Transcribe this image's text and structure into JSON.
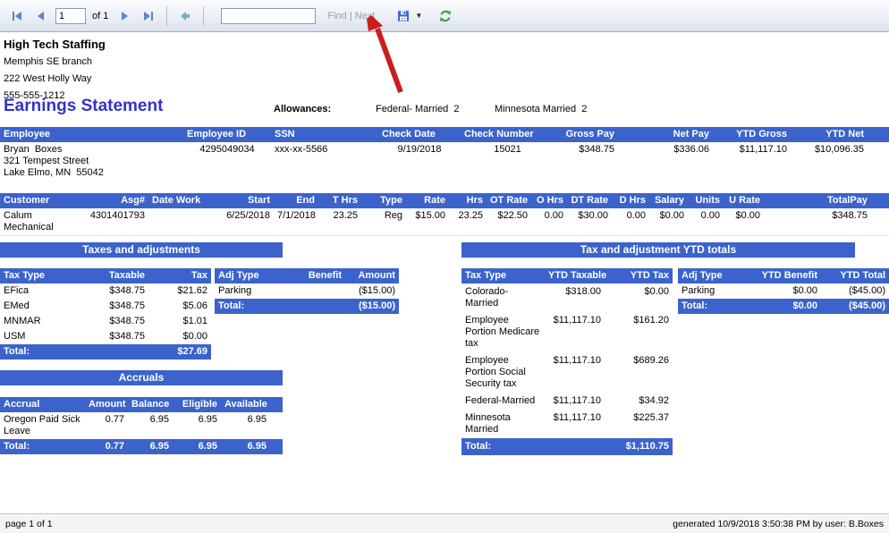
{
  "toolbar": {
    "page_value": "1",
    "of_label": "of 1",
    "find_label": "Find",
    "find_sep": "|",
    "next_label": "Next"
  },
  "company": {
    "name": "High Tech Staffing",
    "branch": "Memphis SE branch",
    "address": "222 West Holly Way",
    "phone": "555-555-1212"
  },
  "statement": {
    "title": "Earnings Statement",
    "allowances_label": "Allowances:",
    "federal_allowance": "Federal- Married  2",
    "state_allowance": "Minnesota Married  2"
  },
  "employee_table": {
    "headers": [
      "Employee",
      "Employee ID",
      "SSN",
      "Check Date",
      "Check Number",
      "Gross Pay",
      "Net Pay",
      "YTD Gross",
      "YTD Net"
    ],
    "row": {
      "name": "Bryan  Boxes",
      "address1": "321 Tempest Street",
      "address2": "Lake Elmo, MN  55042",
      "values": [
        "4295049034",
        "xxx-xx-5566",
        "9/19/2018",
        "15021",
        "$348.75",
        "$336.06",
        "$11,117.10",
        "$10,096.35"
      ]
    }
  },
  "assignment_table": {
    "headers": [
      "Customer",
      "Asg#",
      "Date Work",
      "Start",
      "End",
      "T Hrs",
      "Type",
      "Rate",
      "Hrs",
      "OT Rate",
      "O Hrs",
      "DT Rate",
      "D Hrs",
      "Salary",
      "Units",
      "U Rate",
      "TotalPay"
    ],
    "row": [
      "Calum Mechanical",
      "4301401793",
      "",
      "6/25/2018",
      "7/1/2018",
      "23.25",
      "Reg",
      "$15.00",
      "23.25",
      "$22.50",
      "0.00",
      "$30.00",
      "0.00",
      "$0.00",
      "0.00",
      "$0.00",
      "$348.75"
    ]
  },
  "taxes_section": {
    "title": "Taxes and adjustments",
    "tax_table": {
      "headers": [
        "Tax Type",
        "Taxable",
        "Tax"
      ],
      "rows": [
        [
          "EFica",
          "$348.75",
          "$21.62"
        ],
        [
          "EMed",
          "$348.75",
          "$5.06"
        ],
        [
          "MNMAR",
          "$348.75",
          "$1.01"
        ],
        [
          "USM",
          "$348.75",
          "$0.00"
        ]
      ],
      "total_label": "Total:",
      "total_value": "$27.69"
    },
    "adj_table": {
      "headers": [
        "Adj Type",
        "Benefit",
        "Amount"
      ],
      "rows": [
        [
          "Parking",
          "",
          "($15.00)"
        ]
      ],
      "total_label": "Total:",
      "total_value": "($15.00)"
    }
  },
  "accruals_section": {
    "title": "Accruals",
    "headers": [
      "Accrual",
      "Amount",
      "Balance",
      "Eligible",
      "Available"
    ],
    "rows": [
      [
        "Oregon Paid Sick Leave",
        "0.77",
        "6.95",
        "6.95",
        "6.95"
      ]
    ],
    "total": [
      "Total:",
      "0.77",
      "6.95",
      "6.95",
      "6.95"
    ]
  },
  "ytd_section": {
    "title": "Tax and adjustment YTD totals",
    "tax_table": {
      "headers": [
        "Tax Type",
        "YTD Taxable",
        "YTD Tax"
      ],
      "rows": [
        [
          "Colorado-Married",
          "$318.00",
          "$0.00"
        ],
        [
          "Employee Portion Medicare tax",
          "$11,117.10",
          "$161.20"
        ],
        [
          "Employee Portion Social Security tax",
          "$11,117.10",
          "$689.26"
        ],
        [
          "Federal-Married",
          "$11,117.10",
          "$34.92"
        ],
        [
          "Minnesota Married",
          "$11,117.10",
          "$225.37"
        ]
      ],
      "total_label": "Total:",
      "total_value": "$1,110.75"
    },
    "adj_table": {
      "headers": [
        "Adj Type",
        "YTD Benefit",
        "YTD Total"
      ],
      "rows": [
        [
          "Parking",
          "$0.00",
          "($45.00)"
        ]
      ],
      "total": [
        "Total:",
        "$0.00",
        "($45.00)"
      ]
    }
  },
  "footer": {
    "page_text": "page 1 of 1",
    "generated_text": "generated 10/9/2018 3:50:38 PM by user: B.Boxes"
  },
  "colors": {
    "header_blue": "#3b63cb",
    "title_blue": "#3333cc",
    "annotation_arrow_red": "#c81e1e"
  }
}
